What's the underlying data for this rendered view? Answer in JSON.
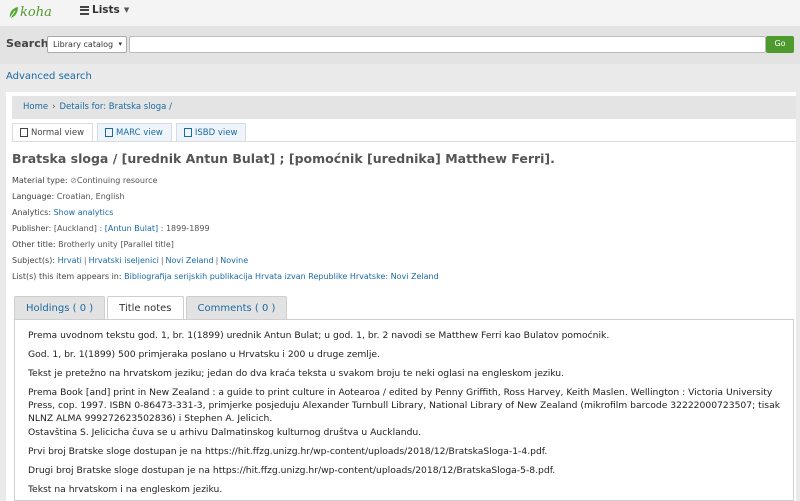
{
  "topbar": {
    "logo_text": "koha",
    "lists_label": "Lists",
    "colors": {
      "brand_green": "#4f9a2f",
      "link_blue": "#1a6aa1"
    }
  },
  "search": {
    "label": "Search",
    "scope_selected": "Library catalog",
    "query": "",
    "go_label": "Go"
  },
  "advanced_search_label": "Advanced search",
  "breadcrumb": {
    "home": "Home",
    "separator": "›",
    "details": "Details for: Bratska sloga /"
  },
  "view_tabs": [
    {
      "label": "Normal view",
      "icon": "document-icon"
    },
    {
      "label": "MARC view",
      "icon": "list-icon"
    },
    {
      "label": "ISBD view",
      "icon": "list-icon"
    }
  ],
  "record": {
    "title": "Bratska sloga / [urednik Antun Bulat] ; [pomoćnik [urednika] Matthew Ferri].",
    "material_type_label": "Material type:",
    "material_type": "Continuing resource",
    "language_label": "Language:",
    "language": "Croatian, English",
    "analytics_label": "Analytics:",
    "analytics": "Show analytics",
    "publisher_label": "Publisher:",
    "publisher_place": "[Auckland]",
    "publisher_colon": ":",
    "publisher_name": "[Antun Bulat]",
    "publisher_date": ": 1899-1899",
    "other_title_label": "Other title:",
    "other_title": "Brotherly unity [Parallel title]",
    "subjects_label": "Subject(s):",
    "subjects": [
      "Hrvati",
      "Hrvatski iseljenici",
      "Novi Zeland",
      "Novine"
    ],
    "lists_label": "List(s) this item appears in:",
    "lists": "Bibliografija serijskih publikacija Hrvata izvan Republike Hrvatske: Novi Zeland"
  },
  "bottom_tabs": [
    {
      "label": "Holdings ( 0 )",
      "active": false
    },
    {
      "label": "Title notes",
      "active": true
    },
    {
      "label": "Comments ( 0 )",
      "active": false
    }
  ],
  "notes": [
    "Prema uvodnom tekstu god. 1, br. 1(1899) urednik Antun Bulat; u god. 1, br. 2 navodi se Matthew Ferri kao Bulatov pomoćnik.",
    "God. 1, br. 1(1899) 500 primjeraka poslano u Hrvatsku i 200 u druge zemlje.",
    "Tekst je pretežno na hrvatskom jeziku; jedan do dva kraća teksta u svakom broju te neki oglasi na engleskom jeziku.",
    "Prema Book [and] print in New Zealand : a guide to print culture in Aotearoa / edited by Penny Griffith, Ross Harvey, Keith Maslen. Wellington : Victoria University Press, cop. 1997. ISBN 0-86473-331-3, primjerke posjeduju Alexander Turnbull Library, National Library of New Zealand (mikrofilm barcode 32222000723507; tisak NLNZ ALMA 999272623502836) i Stephen A. Jelicich.",
    "Ostavština S. Jelicicha čuva se u arhivu Dalmatinskog kulturnog društva u Aucklandu.",
    "Prvi broj Bratske sloge dostupan je na https://hit.ffzg.unizg.hr/wp-content/uploads/2018/12/BratskaSloga-1-4.pdf.",
    "Drugi broj Bratske sloge dostupan je na https://hit.ffzg.unizg.hr/wp-content/uploads/2018/12/BratskaSloga-5-8.pdf.",
    "Tekst na hrvatskom i na engleskom jeziku."
  ]
}
